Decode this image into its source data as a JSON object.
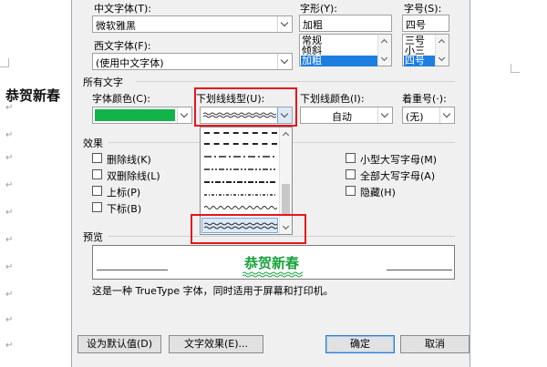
{
  "document": {
    "title": "恭贺新春",
    "para_marks": [
      "↵",
      "↵",
      "↵",
      "↵",
      "↵",
      "↵",
      "↵",
      "↵",
      "↵",
      "↵"
    ]
  },
  "dialog": {
    "chinese_font": {
      "label": "中文字体(T):",
      "value": "微软雅黑"
    },
    "western_font": {
      "label": "西文字体(F):",
      "value": "(使用中文字体)"
    },
    "style": {
      "label": "字形(Y):",
      "value": "加粗",
      "options": [
        "常规",
        "倾斜",
        "加粗"
      ],
      "selected": "加粗"
    },
    "size": {
      "label": "字号(S):",
      "value": "四号",
      "options": [
        "三号",
        "小三",
        "四号"
      ],
      "selected": "四号"
    },
    "all_text": {
      "section_title": "所有文字",
      "font_color": {
        "label": "字体颜色(C):",
        "color": "#12b34a"
      },
      "underline_type": {
        "label": "下划线线型(U):"
      },
      "underline_color": {
        "label": "下划线颜色(I):",
        "value": "自动"
      },
      "emphasis": {
        "label": "着重号(·):",
        "value": "(无)"
      }
    },
    "effects": {
      "section_title": "效果",
      "strikethrough": "删除线(K)",
      "double_strikethrough": "双删除线(L)",
      "superscript": "上标(P)",
      "subscript": "下标(B)",
      "small_caps": "小型大写字母(M)",
      "all_caps": "全部大写字母(A)",
      "hidden": "隐藏(H)"
    },
    "preview": {
      "section_title": "预览",
      "sample": "恭贺新春",
      "description": "这是一种 TrueType 字体，同时适用于屏幕和打印机。"
    },
    "buttons": {
      "set_default": "设为默认值(D)",
      "text_effects": "文字效果(E)...",
      "ok": "确定",
      "cancel": "取消"
    }
  },
  "highlight_color": "#e8141c"
}
